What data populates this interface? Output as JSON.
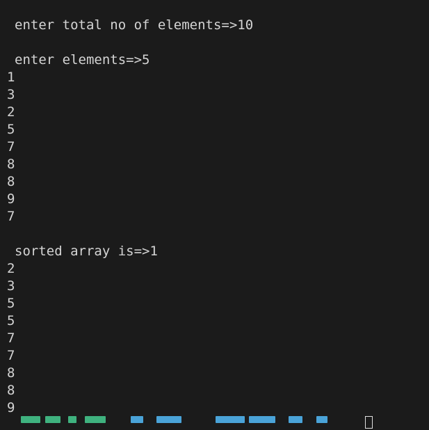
{
  "terminal": {
    "prompt_total": "enter total no of elements=>10",
    "prompt_elements": "enter elements=>5",
    "input_values": [
      "1",
      "3",
      "2",
      "5",
      "7",
      "8",
      "8",
      "9",
      "7"
    ],
    "sorted_header": "sorted array is=>1",
    "sorted_values": [
      "2",
      "3",
      "5",
      "5",
      "7",
      "7",
      "8",
      "8",
      "9"
    ]
  }
}
